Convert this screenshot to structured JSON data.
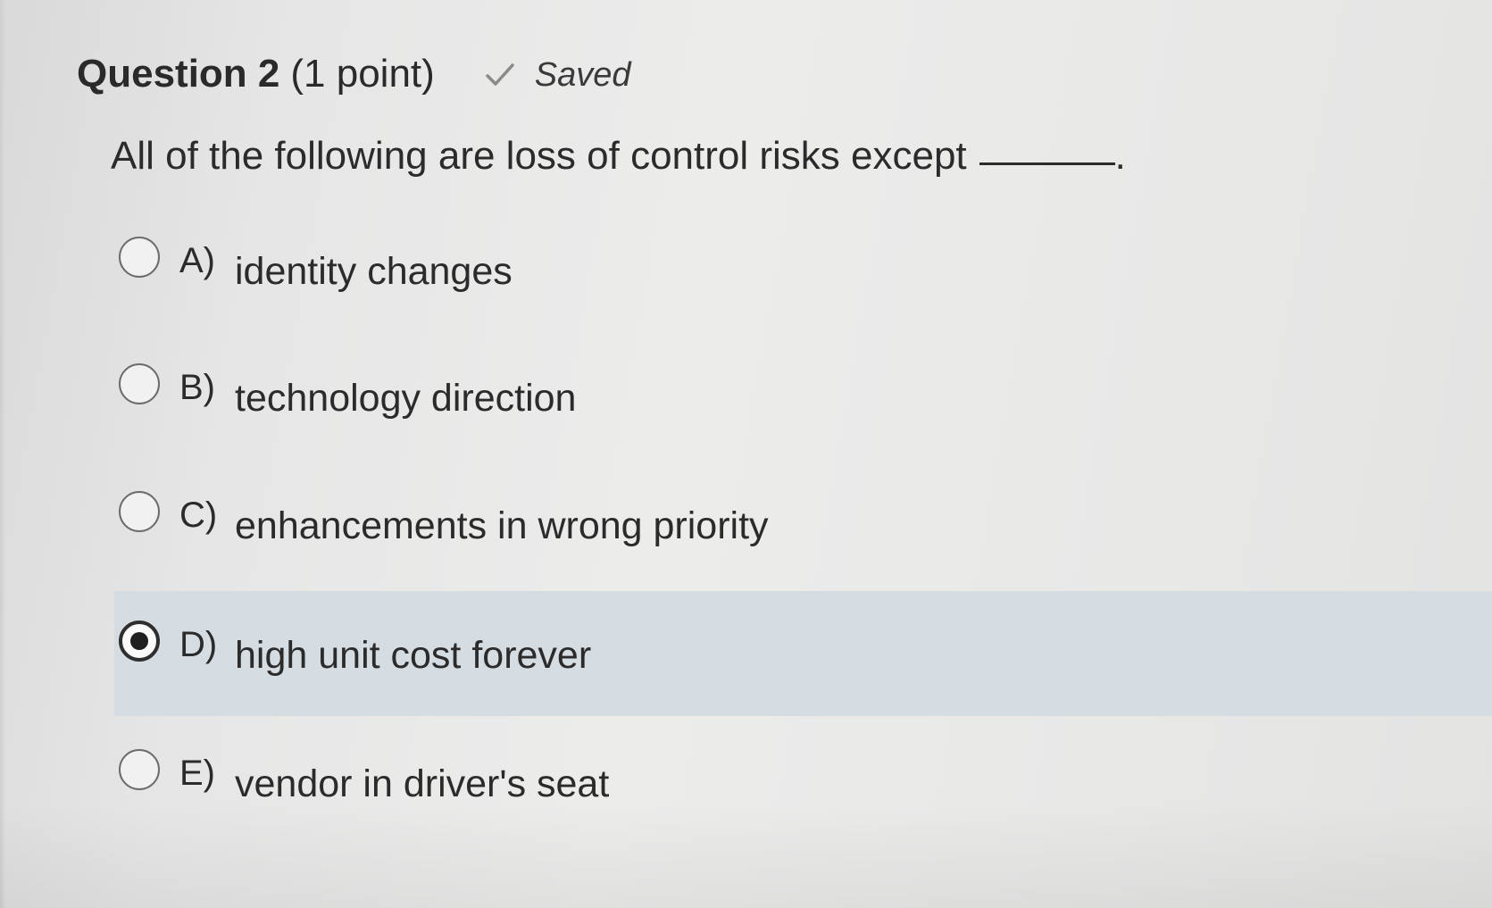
{
  "question": {
    "title": "Question 2",
    "points": "(1 point)",
    "status_icon": "checkmark-icon",
    "status": "Saved",
    "prompt": "All of the following are loss of control risks except",
    "prompt_end": "."
  },
  "options": [
    {
      "letter": "A)",
      "text": "identity changes",
      "selected": false
    },
    {
      "letter": "B)",
      "text": "technology direction",
      "selected": false
    },
    {
      "letter": "C)",
      "text": "enhancements in wrong priority",
      "selected": false
    },
    {
      "letter": "D)",
      "text": "high unit cost forever",
      "selected": true
    },
    {
      "letter": "E)",
      "text": "vendor in driver's seat",
      "selected": false
    }
  ],
  "colors": {
    "selected_row": "#d6dde2",
    "text": "#2b2b2b"
  }
}
